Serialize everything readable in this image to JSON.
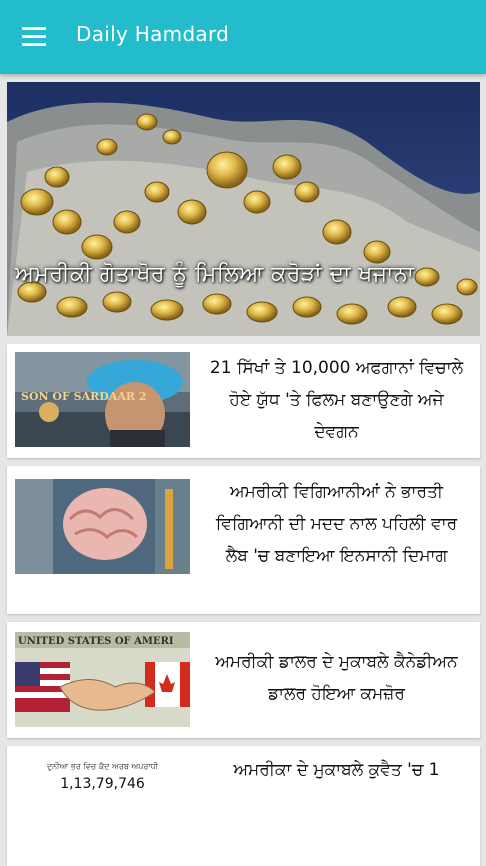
{
  "app": {
    "title": "Daily Hamdard"
  },
  "hero": {
    "title": "ਅਮਰੀਕੀ ਗੋਤਾਖੋਰ ਨੂੰ ਮਿਲਿਆ ਕਰੋੜਾਂ ਦਾ ਖਜਾਨਾ"
  },
  "articles": [
    {
      "title": "21 ਸਿੱਖਾਂ ਤੇ 10,000 ਅਫਗਾਨਾਂ ਵਿਚਾਲੇ ਹੋਏ ਯੁੱਧ 'ਤੇ ਫਿਲਮ ਬਣਾਉਣਗੇ ਅਜੇ ਦੇਵਗਨ",
      "thumb_text": "SON OF SARDAAR 2"
    },
    {
      "title": "ਅਮਰੀਕੀ ਵਿਗਿਆਨੀਆਂ ਨੇ ਭਾਰਤੀ ਵਿਗਿਆਨੀ ਦੀ ਮਦਦ ਨਾਲ ਪਹਿਲੀ ਵਾਰ ਲੈਬ 'ਚ ਬਣਾਇਆ ਇਨਸਾਨੀ ਦਿਮਾਗ"
    },
    {
      "title": "ਅਮਰੀਕੀ ਡਾਲਰ ਦੇ ਮੁਕਾਬਲੇ ਕੈਨੇਡੀਅਨ ਡਾਲਰ ਹੋਇਆ ਕਮਜ਼ੋਰ",
      "thumb_text": "UNITED STATES OF AMERI"
    },
    {
      "title": "ਅਮਰੀਕਾ ਦੇ ਮੁਕਾਬਲੇ ਕੁਵੈਤ 'ਚ 1",
      "thumb_caption": "ਦੁਨੀਆ ਭਰ ਵਿਚ ਕੈਦ ਅਰਬ ਅਪਰਾਧੀ",
      "thumb_number": "1,13,79,746"
    }
  ]
}
